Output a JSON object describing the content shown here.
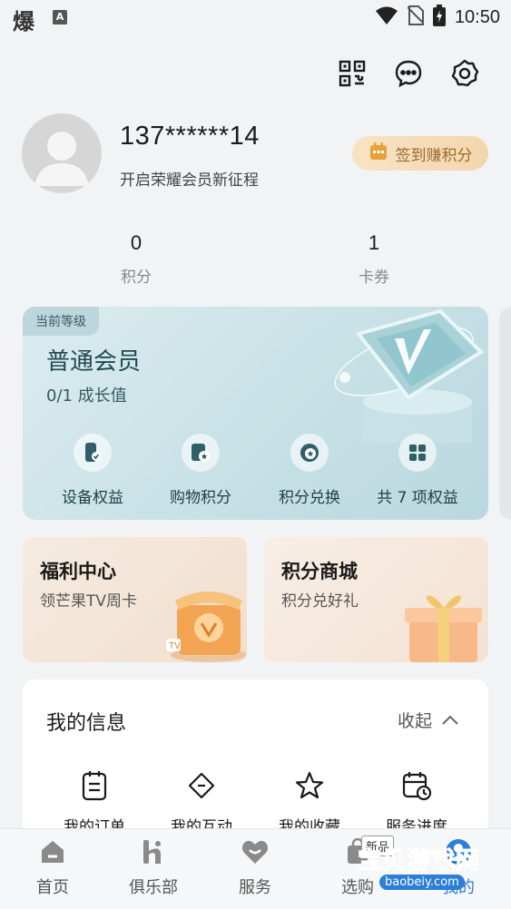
{
  "status_bar": {
    "left_glyph": "爆",
    "input_badge": "A",
    "time": "10:50"
  },
  "top_actions": {
    "icons": [
      "qr-code-icon",
      "message-icon",
      "settings-icon"
    ]
  },
  "profile": {
    "username": "137******14",
    "subtitle": "开启荣耀会员新征程",
    "signin_label": "签到赚积分"
  },
  "stats": [
    {
      "value": "0",
      "label": "积分"
    },
    {
      "value": "1",
      "label": "卡券"
    }
  ],
  "member_card": {
    "tag": "当前等级",
    "level": "普通会员",
    "growth": "0/1 成长值",
    "benefits": [
      {
        "label": "设备权益",
        "icon": "device-icon"
      },
      {
        "label": "购物积分",
        "icon": "shopping-points-icon"
      },
      {
        "label": "积分兑换",
        "icon": "exchange-icon"
      },
      {
        "label": "共 7 项权益",
        "icon": "grid-icon"
      }
    ]
  },
  "promos": [
    {
      "title": "福利中心",
      "subtitle": "领芒果TV周卡"
    },
    {
      "title": "积分商城",
      "subtitle": "积分兑好礼"
    }
  ],
  "info": {
    "title": "我的信息",
    "collapse_label": "收起",
    "items": [
      {
        "label": "我的订单",
        "icon": "order-icon"
      },
      {
        "label": "我的互动",
        "icon": "interaction-icon"
      },
      {
        "label": "我的收藏",
        "icon": "star-icon"
      },
      {
        "label": "服务进度",
        "icon": "service-progress-icon"
      }
    ]
  },
  "bottom_nav": [
    {
      "label": "首页",
      "icon": "home-icon"
    },
    {
      "label": "俱乐部",
      "icon": "club-icon"
    },
    {
      "label": "服务",
      "icon": "heart-icon"
    },
    {
      "label": "选购",
      "icon": "shop-icon"
    },
    {
      "label": "我的",
      "icon": "profile-icon"
    }
  ],
  "watermark": {
    "text": "宝贝游戏网",
    "url": "baobeiy.com",
    "tag": "新品"
  },
  "colors": {
    "background": "#f1f3f5",
    "signin_text": "#9c6b2f",
    "member_card": "#c7e1e6",
    "active_nav": "#2b7fd6"
  }
}
